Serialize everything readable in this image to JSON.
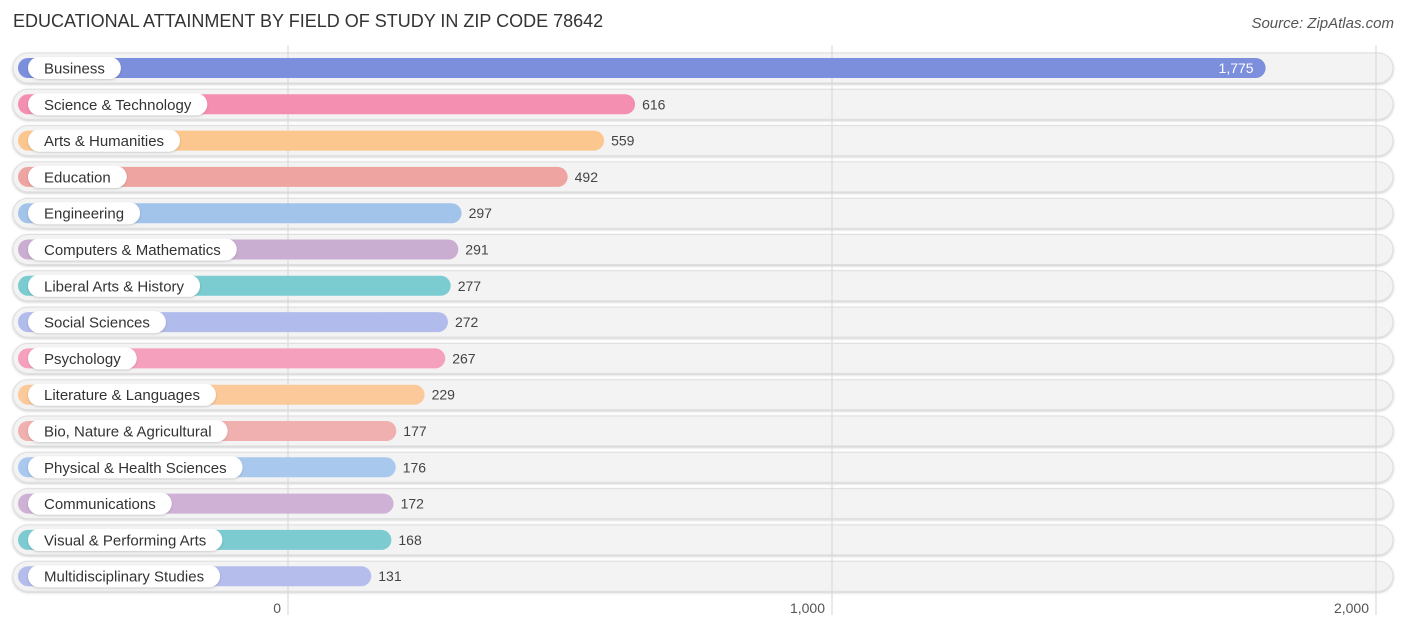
{
  "chart_data": {
    "type": "bar",
    "orientation": "horizontal",
    "title": "EDUCATIONAL ATTAINMENT BY FIELD OF STUDY IN ZIP CODE 78642",
    "source": "Source: ZipAtlas.com",
    "xlabel": "",
    "ylabel": "",
    "xlim": [
      0,
      2000
    ],
    "xticks": [
      0,
      1000,
      2000
    ],
    "xtick_labels": [
      "0",
      "1,000",
      "2,000"
    ],
    "grid": true,
    "categories": [
      "Business",
      "Science & Technology",
      "Arts & Humanities",
      "Education",
      "Engineering",
      "Computers & Mathematics",
      "Liberal Arts & History",
      "Social Sciences",
      "Psychology",
      "Literature & Languages",
      "Bio, Nature & Agricultural",
      "Physical & Health Sciences",
      "Communications",
      "Visual & Performing Arts",
      "Multidisciplinary Studies"
    ],
    "values": [
      1775,
      616,
      559,
      492,
      297,
      291,
      277,
      272,
      267,
      229,
      177,
      176,
      172,
      168,
      131
    ],
    "value_labels": [
      "1,775",
      "616",
      "559",
      "492",
      "297",
      "291",
      "277",
      "272",
      "267",
      "229",
      "177",
      "176",
      "172",
      "168",
      "131"
    ],
    "colors": [
      "#7b8fdc",
      "#f48fb1",
      "#fbc78e",
      "#eea5a2",
      "#a2c4ea",
      "#c9aed1",
      "#7accd1",
      "#b2bcec",
      "#f5a1bd",
      "#fbc99a",
      "#f1b0b0",
      "#a9c8ee",
      "#cfb1d6",
      "#7ccbd0",
      "#b4bdec"
    ]
  }
}
